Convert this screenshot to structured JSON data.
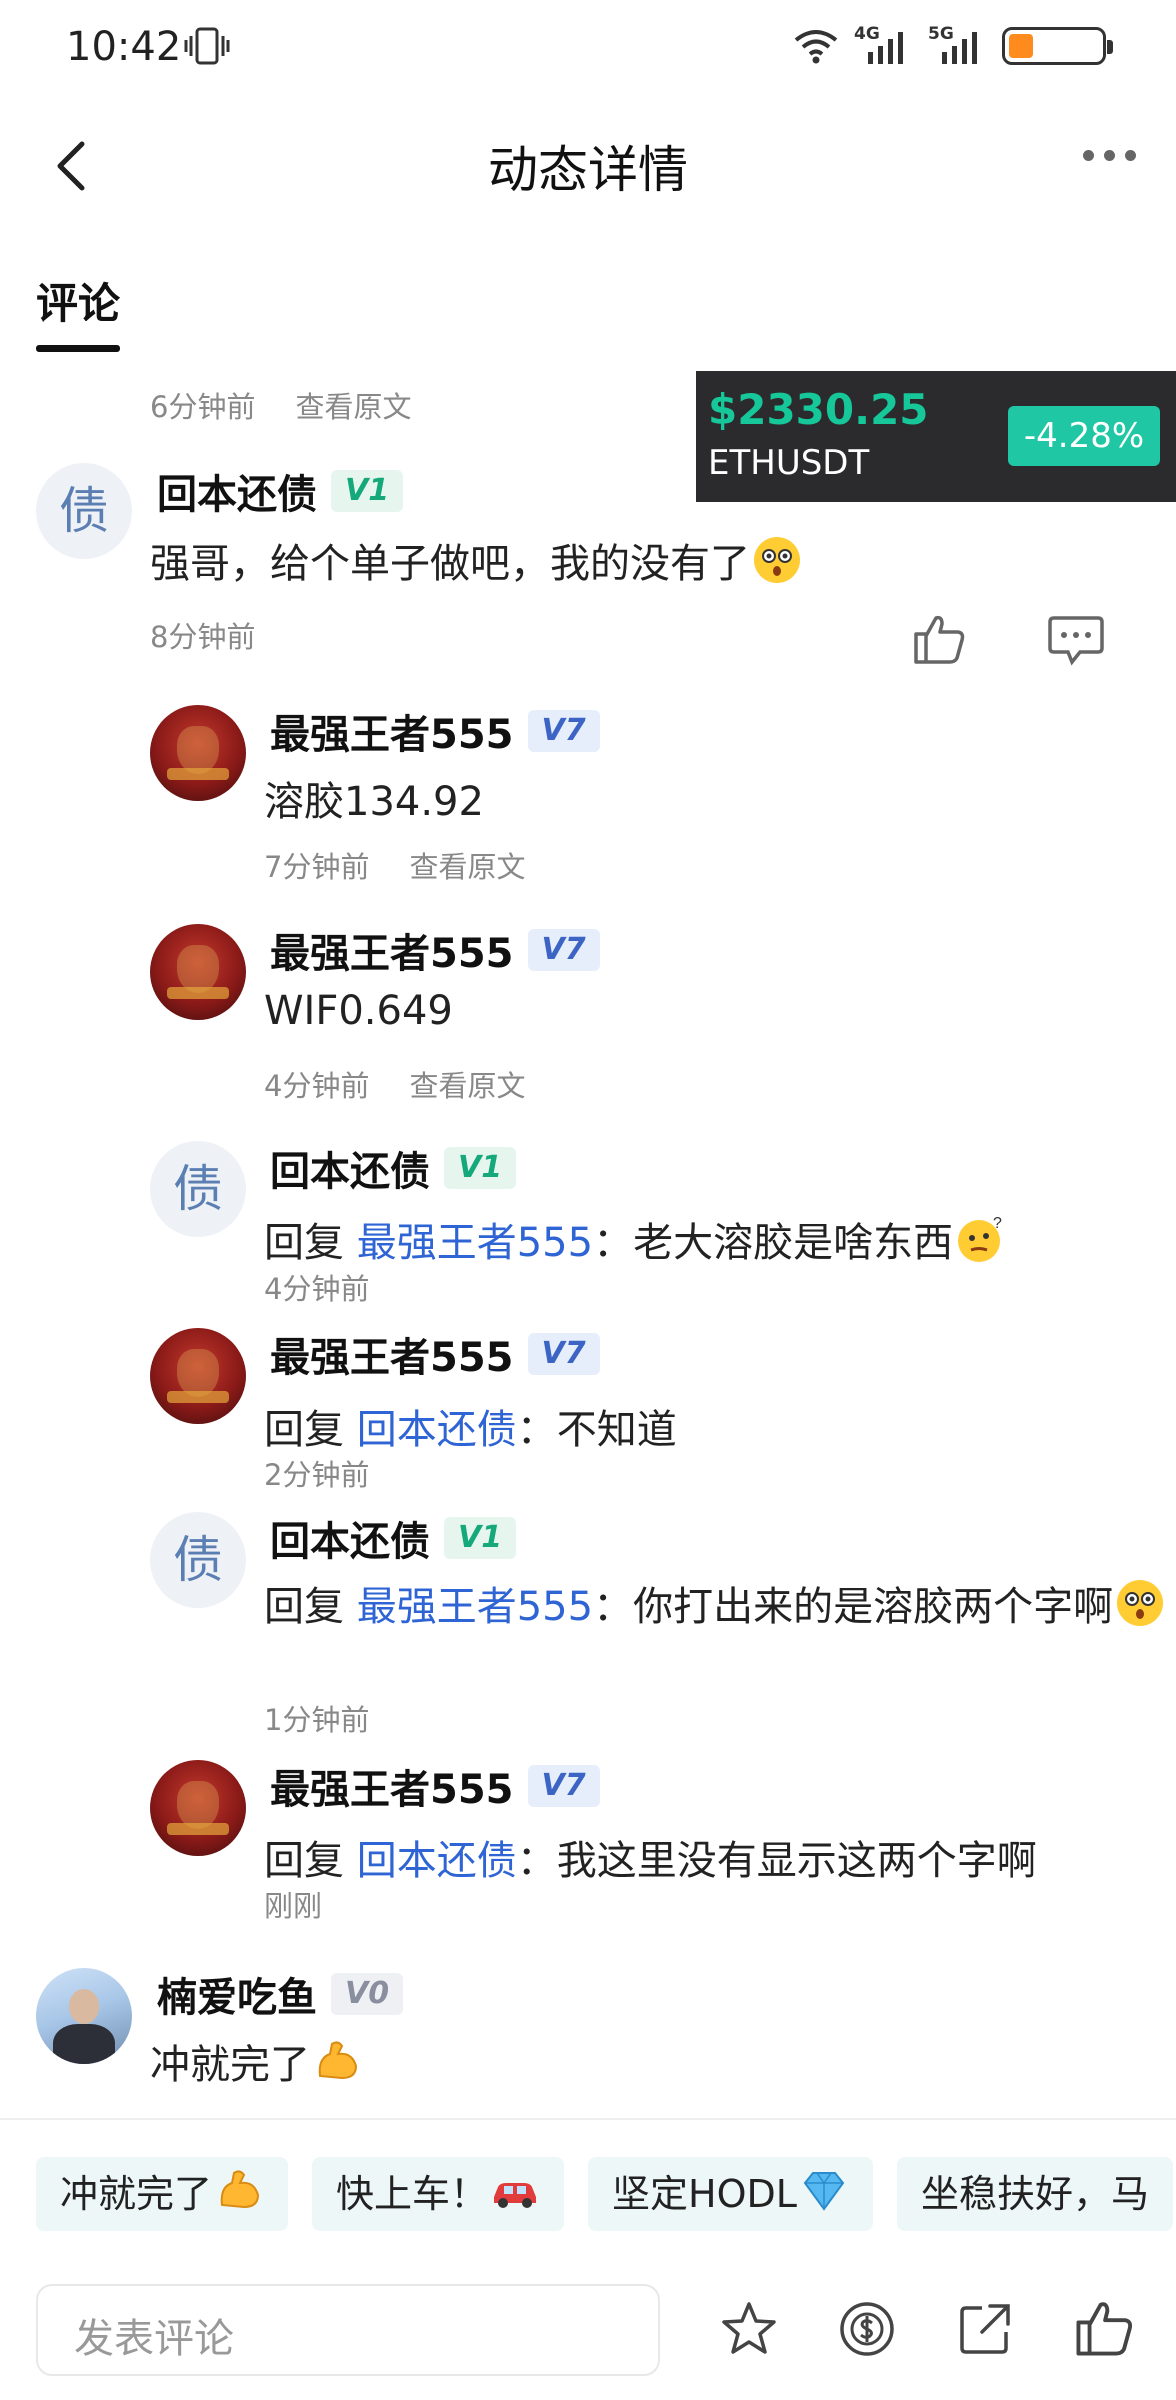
{
  "status_bar": {
    "time": "10:42",
    "net1": "4G",
    "net2": "5G"
  },
  "header": {
    "title": "动态详情"
  },
  "tabs": {
    "active": "评论"
  },
  "ticker": {
    "price": "$2330.25",
    "pair": "ETHUSDT",
    "change": "-4.28%"
  },
  "top_meta": {
    "time": "6分钟前",
    "view_original": "查看原文"
  },
  "comments": [
    {
      "name": "回本还债",
      "level": "V1",
      "avatar_char": "债",
      "text": "强哥，给个单子做吧，我的没有了",
      "time": "8分钟前"
    }
  ],
  "replies": [
    {
      "name": "最强王者555",
      "level": "V7",
      "text": "溶胶134.92",
      "time": "7分钟前",
      "view_original": "查看原文"
    },
    {
      "name": "最强王者555",
      "level": "V7",
      "text": "WIF0.649",
      "time": "4分钟前",
      "view_original": "查看原文"
    },
    {
      "name": "回本还债",
      "level": "V1",
      "avatar_char": "债",
      "reply_prefix": "回复 ",
      "reply_to": "最强王者555",
      "sep": "：",
      "text": "老大溶胶是啥东西",
      "time": "4分钟前"
    },
    {
      "name": "最强王者555",
      "level": "V7",
      "reply_prefix": "回复 ",
      "reply_to": "回本还债",
      "sep": "：",
      "text": "不知道",
      "time": "2分钟前"
    },
    {
      "name": "回本还债",
      "level": "V1",
      "avatar_char": "债",
      "reply_prefix": "回复 ",
      "reply_to": "最强王者555",
      "sep": "：",
      "text": "你打出来的是溶胶两个字啊",
      "time": "1分钟前"
    },
    {
      "name": "最强王者555",
      "level": "V7",
      "reply_prefix": "回复 ",
      "reply_to": "回本还债",
      "sep": "：",
      "text": "我这里没有显示这两个字啊",
      "time": "刚刚"
    }
  ],
  "last_comment": {
    "name": "楠爱吃鱼",
    "level": "V0",
    "text": "冲就完了"
  },
  "quick_replies": [
    "冲就完了",
    "快上车！",
    "坚定HODL",
    "坐稳扶好，马"
  ],
  "bottom_bar": {
    "input_placeholder": "发表评论"
  },
  "colors": {
    "accent_green": "#16c79a",
    "mention_blue": "#2f64d4",
    "down_badge": "#1fc7a4"
  },
  "icons": [
    "back-icon",
    "more-icon",
    "like-icon",
    "comment-icon",
    "star-icon",
    "coin-icon",
    "share-icon",
    "wifi-icon",
    "battery-icon",
    "vibrate-icon"
  ]
}
